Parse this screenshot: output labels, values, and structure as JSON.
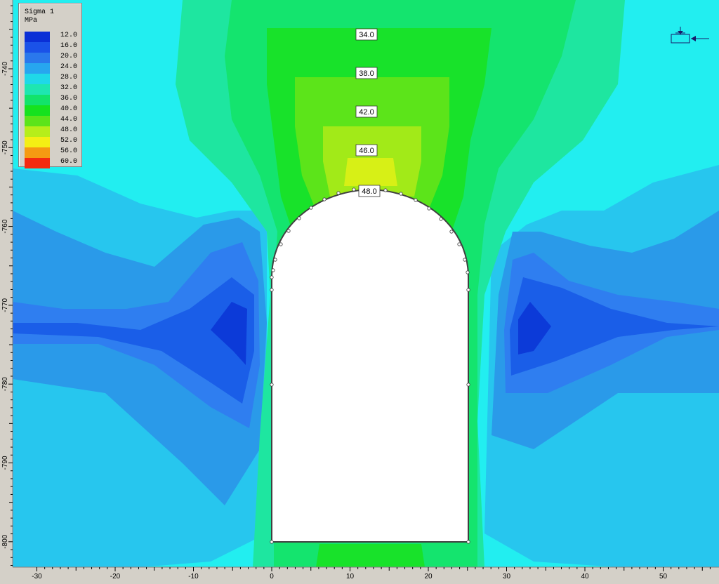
{
  "legend": {
    "title": "Sigma 1",
    "unit": "MPa",
    "entries": [
      {
        "label": "12.0",
        "color": "#0a2fd6"
      },
      {
        "label": "16.0",
        "color": "#1a52e8"
      },
      {
        "label": "20.0",
        "color": "#2a78ec"
      },
      {
        "label": "24.0",
        "color": "#27a6ef"
      },
      {
        "label": "28.0",
        "color": "#1fd8e8"
      },
      {
        "label": "32.0",
        "color": "#1ee6b0"
      },
      {
        "label": "36.0",
        "color": "#12e36a"
      },
      {
        "label": "40.0",
        "color": "#16e21e"
      },
      {
        "label": "44.0",
        "color": "#5ce41a"
      },
      {
        "label": "48.0",
        "color": "#b6ee1a"
      },
      {
        "label": "52.0",
        "color": "#f4ef14"
      },
      {
        "label": "56.0",
        "color": "#f59a12"
      },
      {
        "label": "60.0",
        "color": "#f42a10"
      }
    ]
  },
  "x_axis_ticks": [
    "-30",
    "-20",
    "-10",
    "0",
    "10",
    "20",
    "30",
    "40",
    "50"
  ],
  "y_axis_ticks": [
    "-740",
    "-750",
    "-760",
    "-770",
    "-780",
    "-790",
    "-800"
  ],
  "contour_labels": [
    "34.0",
    "38.0",
    "42.0",
    "46.0",
    "48.0"
  ],
  "colors": {
    "background_field": "#22eef0",
    "excavation": "#ffffff",
    "excavation_outline": "#404040",
    "ruler_bg": "#d4d0c8"
  },
  "icons": {
    "support_marker": "pinned-support-arrow-icon"
  }
}
